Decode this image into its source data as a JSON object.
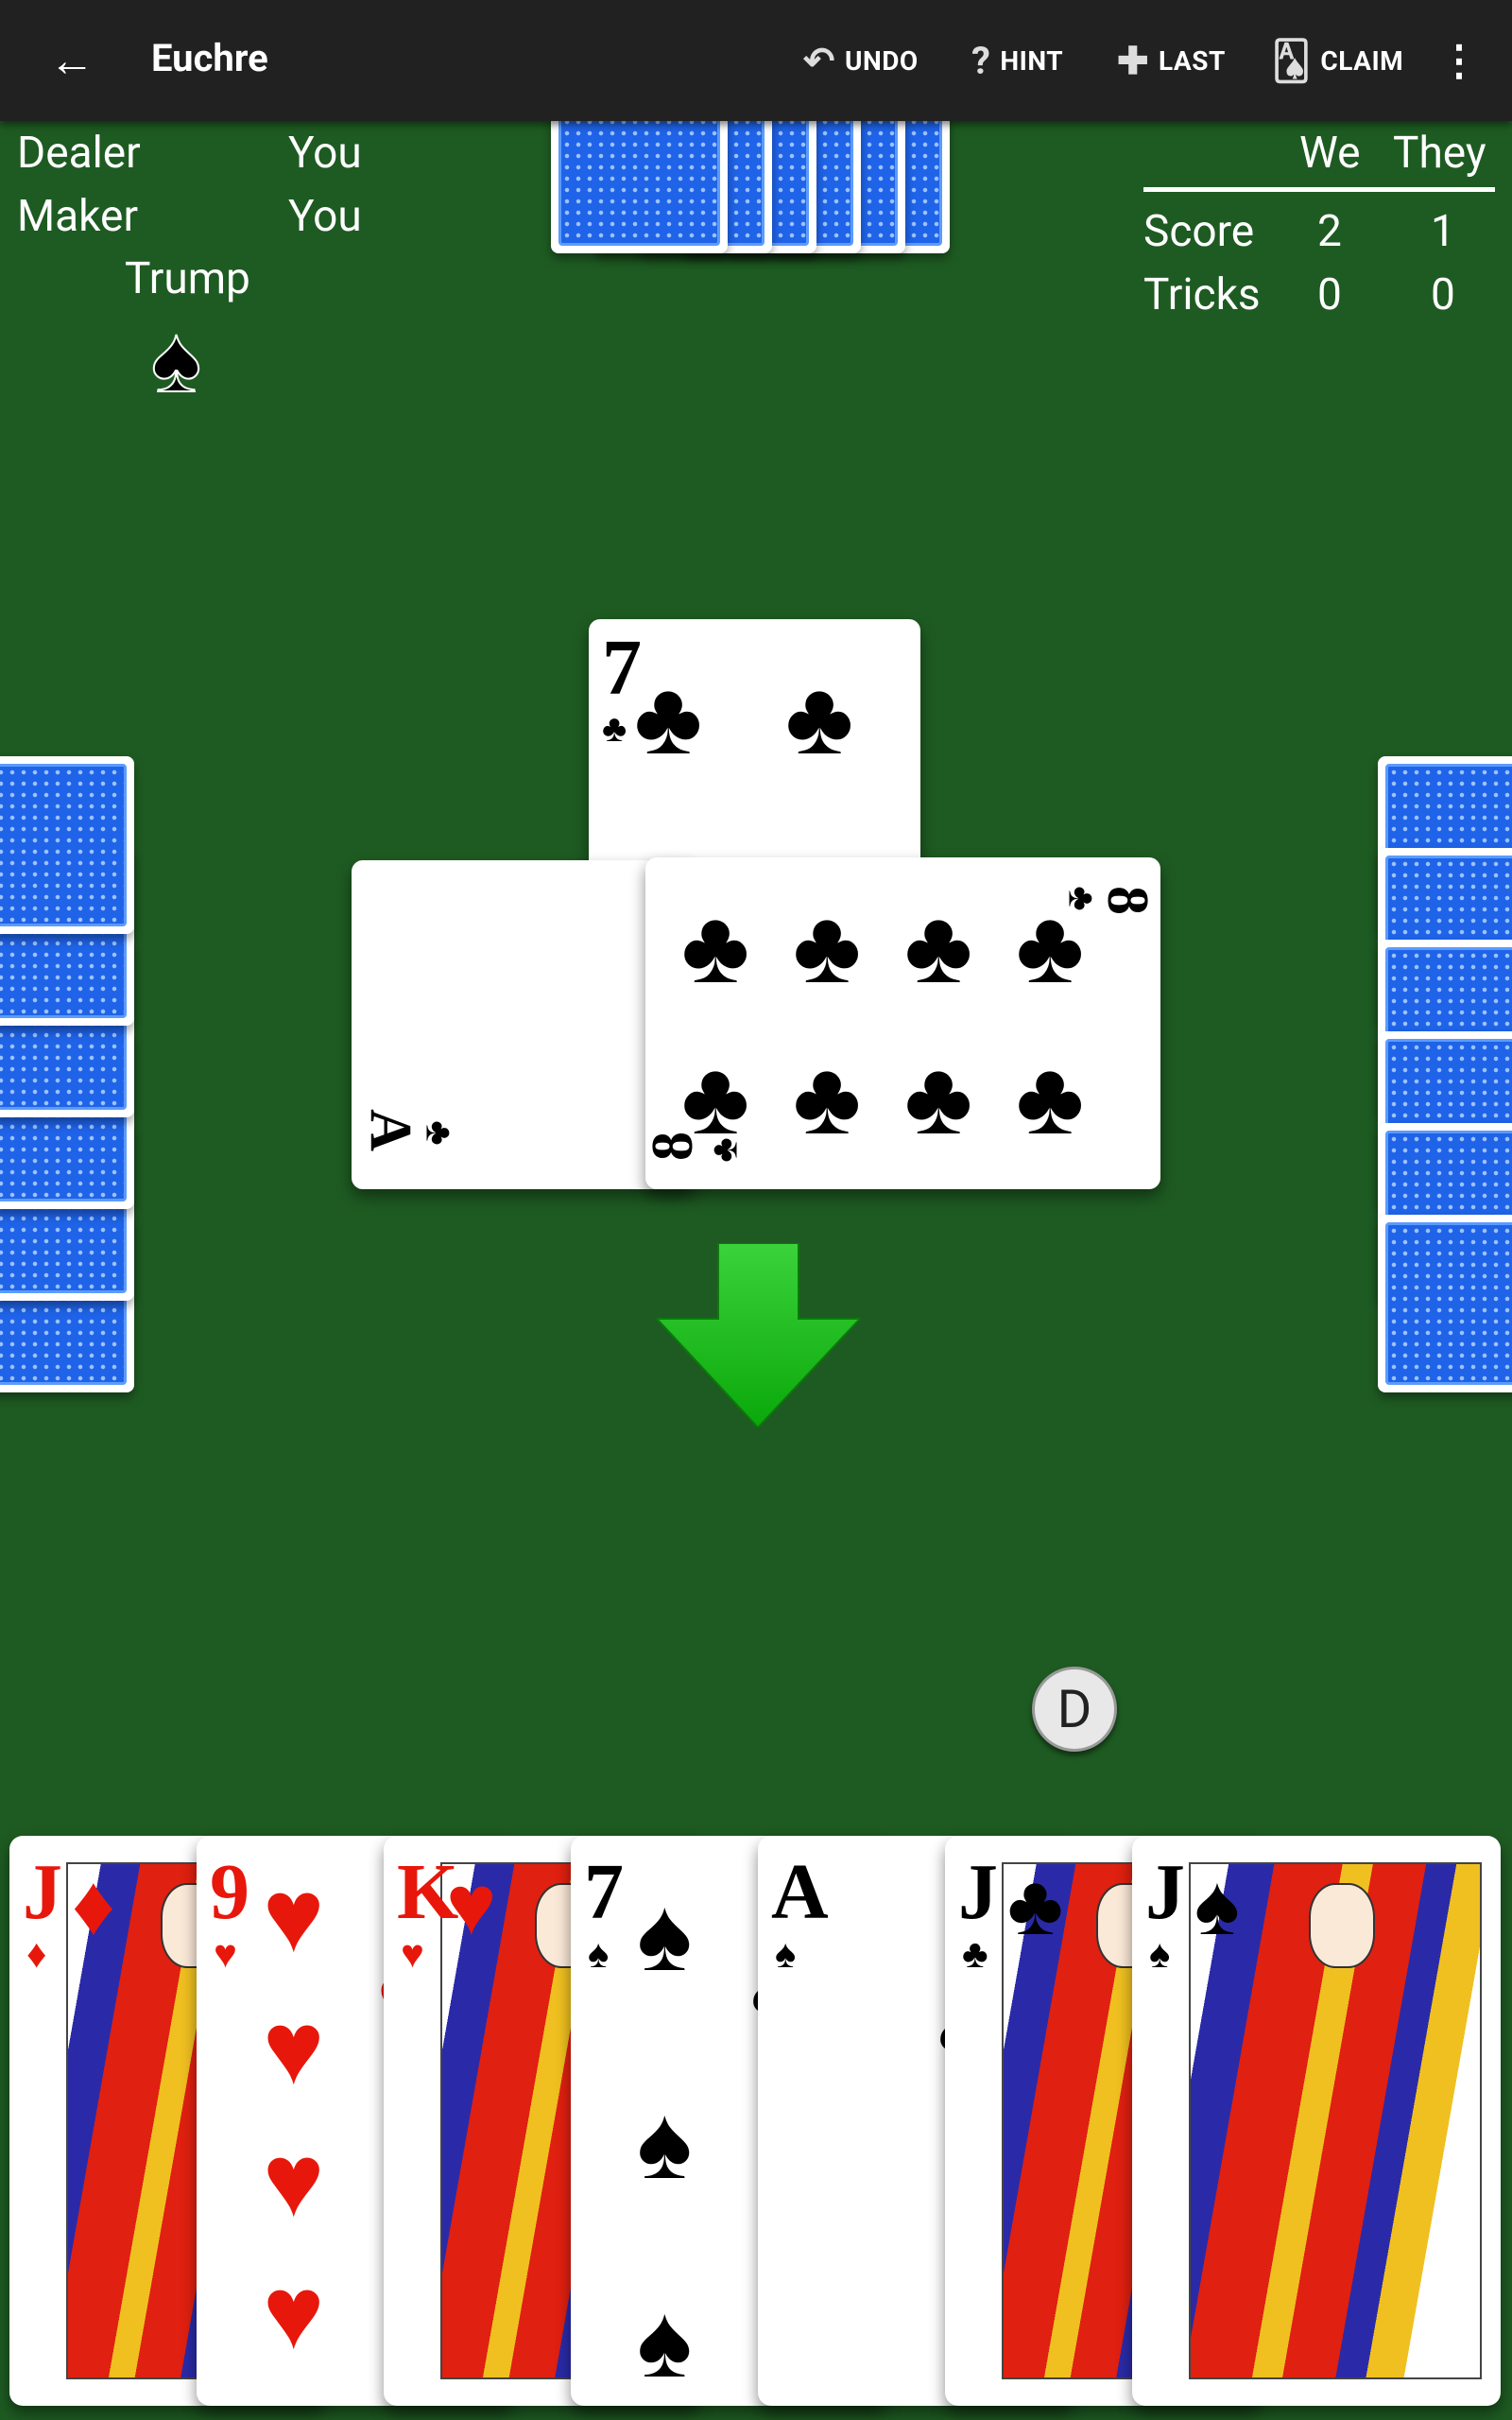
{
  "toolbar": {
    "back_icon": "arrow-left-icon",
    "title": "Euchre",
    "undo": "UNDO",
    "hint": "HINT",
    "last": "LAST",
    "claim": "CLAIM",
    "menu_icon": "more-vert-icon"
  },
  "info": {
    "dealer_label": "Dealer",
    "dealer_value": "You",
    "maker_label": "Maker",
    "maker_value": "You",
    "trump_label": "Trump",
    "trump_suit": "♠"
  },
  "score": {
    "we": "We",
    "they": "They",
    "score_label": "Score",
    "score_we": "2",
    "score_they": "1",
    "tricks_label": "Tricks",
    "tricks_we": "0",
    "tricks_they": "0"
  },
  "trick": {
    "top": {
      "rank": "7",
      "suit": "♣"
    },
    "left": {
      "rank": "A",
      "suit": "♣"
    },
    "right": {
      "rank": "8",
      "suit": "♣"
    }
  },
  "dealer_button": "D",
  "opponents": {
    "partner_cards": 6,
    "left_cards": 6,
    "right_cards": 6
  },
  "hand": [
    {
      "rank": "J",
      "suit": "♦",
      "color": "red",
      "face": true
    },
    {
      "rank": "9",
      "suit": "♥",
      "color": "red",
      "face": false
    },
    {
      "rank": "K",
      "suit": "♥",
      "color": "red",
      "face": true
    },
    {
      "rank": "7",
      "suit": "♠",
      "color": "blk",
      "face": false
    },
    {
      "rank": "A",
      "suit": "♠",
      "color": "blk",
      "face": false
    },
    {
      "rank": "J",
      "suit": "♣",
      "color": "blk",
      "face": true
    },
    {
      "rank": "J",
      "suit": "♠",
      "color": "blk",
      "face": true
    }
  ],
  "colors": {
    "felt": "#1e5b22",
    "toolbar": "#212121",
    "card_back": "#1f63e8",
    "arrow": "#17c617",
    "red_suit": "#e8170b"
  }
}
